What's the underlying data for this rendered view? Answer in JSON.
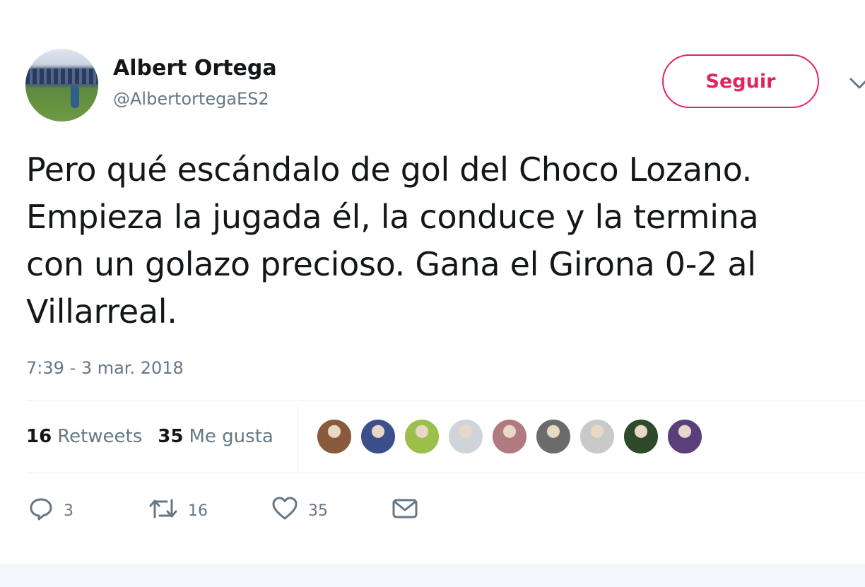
{
  "user": {
    "display_name": "Albert Ortega",
    "handle": "@AlbertortegaES2"
  },
  "follow_button": {
    "label": "Seguir",
    "color": "#e0245e"
  },
  "tweet": {
    "lines": [
      "Pero qué escándalo de gol del Choco Lozano.",
      "Empieza la jugada él, la conduce y la termina",
      "con un golazo precioso. Gana el Girona 0-2 al",
      "Villarreal."
    ],
    "timestamp": "7:39 - 3 mar. 2018"
  },
  "stats": {
    "retweets_count": "16",
    "retweets_label": "Retweets",
    "likes_count": "35",
    "likes_label": "Me gusta"
  },
  "liker_avatars": [
    {
      "color": "#8a5a3c"
    },
    {
      "color": "#3d4f8a"
    },
    {
      "color": "#9bbf4a"
    },
    {
      "color": "#cfd4da"
    },
    {
      "color": "#b07a80"
    },
    {
      "color": "#6b6b6b"
    },
    {
      "color": "#c9c9c9"
    },
    {
      "color": "#2f4a2a"
    },
    {
      "color": "#5a3f7a"
    }
  ],
  "actions": {
    "reply": {
      "icon": "reply-icon",
      "count": "3"
    },
    "retweet": {
      "icon": "retweet-icon",
      "count": "16"
    },
    "like": {
      "icon": "heart-icon",
      "count": "35"
    },
    "message": {
      "icon": "envelope-icon"
    }
  },
  "colors": {
    "text": "#14171a",
    "secondary": "#657786",
    "accent": "#e0245e"
  }
}
